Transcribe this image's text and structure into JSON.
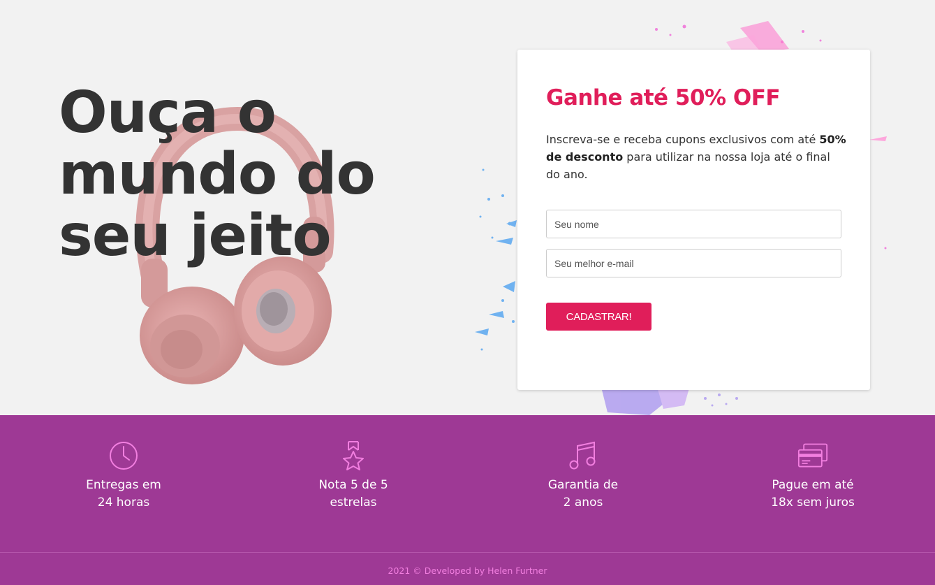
{
  "hero": {
    "headline_lines": [
      "Ouça o",
      "mundo do",
      "seu jeito"
    ]
  },
  "signup": {
    "title": "Ganhe até 50% OFF",
    "desc_part1": "Inscreva-se e receba cupons exclusivos com até ",
    "desc_bold": "50% de desconto",
    "desc_part2": " para utilizar na nossa loja até o final do ano.",
    "name_placeholder": "Seu nome",
    "email_placeholder": "Seu melhor e-mail",
    "submit_label": "CADASTRAR!"
  },
  "features": [
    {
      "icon": "clock-icon",
      "label": "Entregas em\n24 horas"
    },
    {
      "icon": "award-star-icon",
      "label": "Nota 5 de 5\nestrelas"
    },
    {
      "icon": "music-note-icon",
      "label": "Garantia de\n2 anos"
    },
    {
      "icon": "credit-card-icon",
      "label": "Pague em até\n18x sem juros"
    }
  ],
  "footer": {
    "text": "2021 © Developed by Helen Furtner"
  },
  "colors": {
    "accent": "#e01e5a",
    "features_bg": "#9e3995",
    "icon_pink": "#f27fe0"
  }
}
